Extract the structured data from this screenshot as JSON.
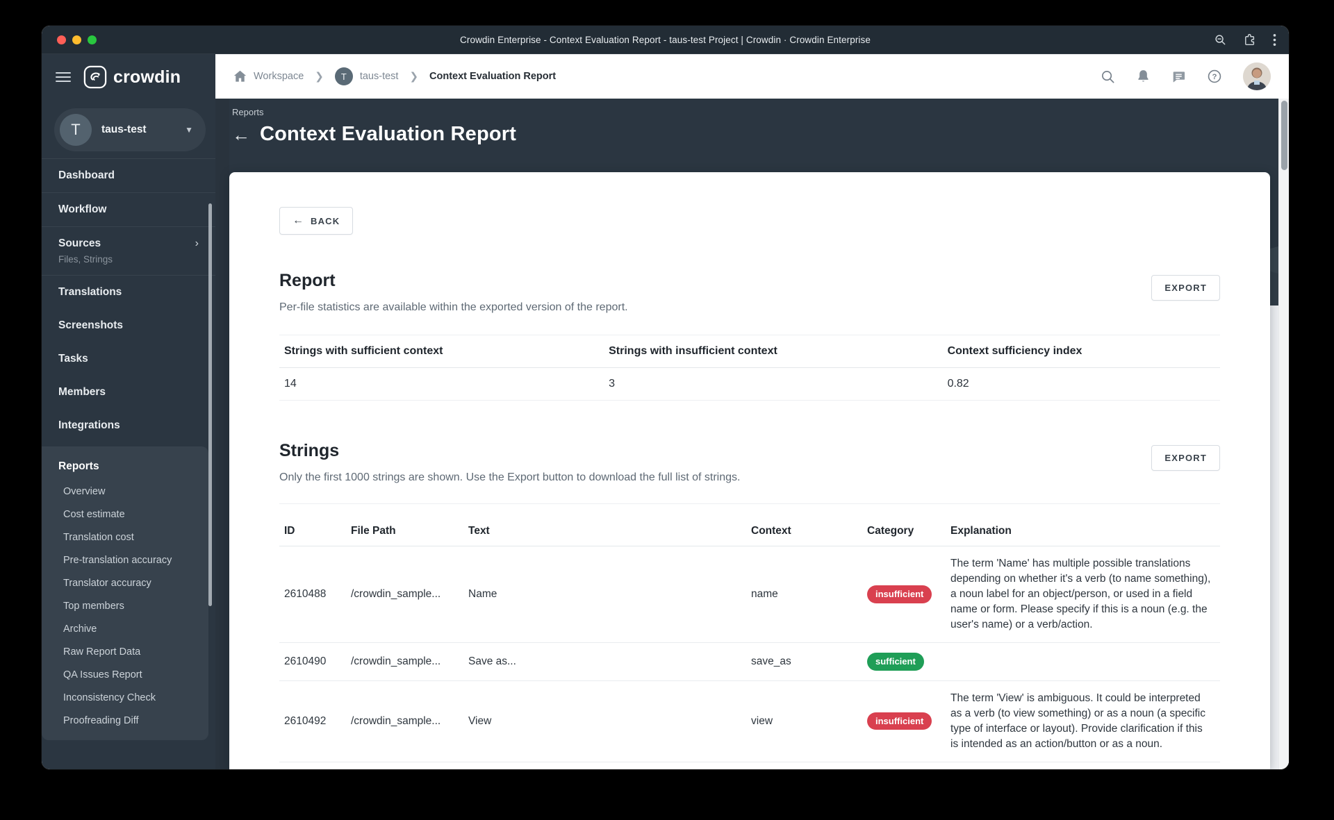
{
  "theme": {
    "badge_insufficient": "#d9404f",
    "badge_sufficient": "#1f9e57",
    "brand_dark": "#2b3641"
  },
  "titlebar": {
    "title": "Crowdin Enterprise - Context Evaluation Report - taus-test Project | Crowdin · Crowdin Enterprise"
  },
  "sidebar": {
    "brand": "crowdin",
    "project": {
      "initial": "T",
      "name": "taus-test"
    },
    "nav": {
      "dashboard": "Dashboard",
      "workflow": "Workflow",
      "sources": "Sources",
      "sources_sub": "Files, Strings",
      "sources_chevron": "›",
      "translations": "Translations",
      "screenshots": "Screenshots",
      "tasks": "Tasks",
      "members": "Members",
      "integrations": "Integrations"
    },
    "reports": {
      "label": "Reports",
      "items": [
        "Overview",
        "Cost estimate",
        "Translation cost",
        "Pre-translation accuracy",
        "Translator accuracy",
        "Top members",
        "Archive",
        "Raw Report Data",
        "QA Issues Report",
        "Inconsistency Check",
        "Proofreading Diff"
      ]
    }
  },
  "breadcrumb": {
    "workspace": "Workspace",
    "separator": "❯",
    "project_initial": "T",
    "project": "taus-test",
    "current": "Context Evaluation Report"
  },
  "page_header": {
    "eyebrow": "Reports",
    "back_arrow": "←",
    "title": "Context Evaluation Report"
  },
  "report": {
    "back_label": "BACK",
    "back_arrow": "←",
    "heading": "Report",
    "description": "Per-file statistics are available within the exported version of the report.",
    "export_label": "EXPORT",
    "stats": {
      "headers": [
        "Strings with sufficient context",
        "Strings with insufficient context",
        "Context sufficiency index"
      ],
      "values": [
        "14",
        "3",
        "0.82"
      ]
    }
  },
  "strings": {
    "heading": "Strings",
    "description": "Only the first 1000 strings are shown. Use the Export button to download the full list of strings.",
    "export_label": "EXPORT",
    "headers": [
      "ID",
      "File Path",
      "Text",
      "Context",
      "Category",
      "Explanation"
    ],
    "rows": [
      {
        "id": "2610488",
        "file_path": "/crowdin_sample...",
        "text": "Name",
        "context": "name",
        "category": "insufficient",
        "explanation": "The term 'Name' has multiple possible translations depending on whether it's a verb (to name something), a noun label for an object/person, or used in a field name or form. Please specify if this is a noun (e.g. the user's name) or a verb/action."
      },
      {
        "id": "2610490",
        "file_path": "/crowdin_sample...",
        "text": "Save as...",
        "context": "save_as",
        "category": "sufficient",
        "explanation": ""
      },
      {
        "id": "2610492",
        "file_path": "/crowdin_sample...",
        "text": "View",
        "context": "view",
        "category": "insufficient",
        "explanation": "The term 'View' is ambiguous. It could be interpreted as a verb (to view something) or as a noun (a specific type of interface or layout). Provide clarification if this is intended as an action/button or as a noun."
      }
    ]
  }
}
